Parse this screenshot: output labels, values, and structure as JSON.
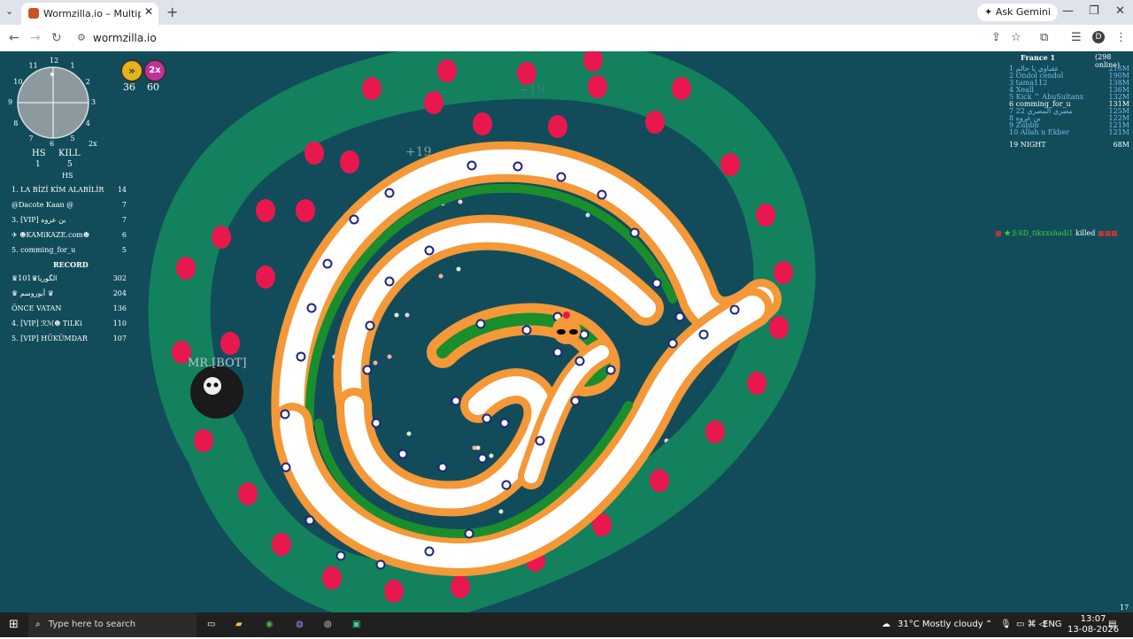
{
  "browser": {
    "tab_title": "Wormzilla.io – Multiplayer Snal",
    "url": "wormzilla.io",
    "ask_gemini": "Ask Gemini",
    "profile_initial": "D"
  },
  "hud": {
    "minimap_numbers": [
      "12",
      "1",
      "2",
      "3",
      "4",
      "5",
      "6",
      "7",
      "8",
      "9",
      "10",
      "11"
    ],
    "zoom_label": "2x",
    "hs_label": "HS",
    "kill_label": "KILL",
    "hs_value": "1",
    "kill_value": "5",
    "hs_section_label": "HS",
    "boost_count": "36",
    "multiplier_badge": "2x",
    "multiplier_count": "60"
  },
  "hs_list": [
    {
      "name": "1. LA BİZİ KİM ALABİLİR",
      "score": "14"
    },
    {
      "name": "@Dacote Kaan @",
      "score": "7"
    },
    {
      "name": "3. [VIP] بن عروه",
      "score": "7"
    },
    {
      "name": "✈ ☻KAMiKAZE.com☻",
      "score": "6"
    },
    {
      "name": "5. comming_for_u",
      "score": "5"
    }
  ],
  "record_label": "RECORD",
  "record_list": [
    {
      "name": "♛101♛الگوریا",
      "score": "302"
    },
    {
      "name": "♛ أبوروسم ♛",
      "score": "204"
    },
    {
      "name": "ÖNCE VATAN",
      "score": "136"
    },
    {
      "name": "4. [VIP] ℛℳ☻ TiLKi",
      "score": "110"
    },
    {
      "name": "5. [VIP] HÜKÜMDAR",
      "score": "107"
    }
  ],
  "server": {
    "name": "France 1",
    "online": "(298 online)"
  },
  "top_leaderboard": [
    {
      "rank": "1",
      "name": "عقباوي يا حالم",
      "score": "216M"
    },
    {
      "rank": "2",
      "name": "Ondol cendol",
      "score": "190M"
    },
    {
      "rank": "3",
      "name": "tama112",
      "score": "138M"
    },
    {
      "rank": "4",
      "name": "Xeall",
      "score": "136M"
    },
    {
      "rank": "5",
      "name": "Kick ^ AbuSultanx",
      "score": "132M"
    },
    {
      "rank": "6",
      "name": "comming_for_u",
      "score": "131M"
    },
    {
      "rank": "7",
      "name": "مصري المصري 22",
      "score": "125M"
    },
    {
      "rank": "8",
      "name": "بن عروه",
      "score": "122M"
    },
    {
      "rank": "9",
      "name": "Zubbb",
      "score": "121M"
    },
    {
      "rank": "10",
      "name": "Allah u Ekber",
      "score": "121M"
    }
  ],
  "own_rank": {
    "rank": "19",
    "name": "NIGHT",
    "score": "68M"
  },
  "kill_feed": {
    "killer": "★彡SD_tikxxshadi1",
    "verb": "killed"
  },
  "bot_label": "MR.[BOT]",
  "floating_points": [
    "+19",
    "+19"
  ],
  "corner_number": "17",
  "taskbar": {
    "search_placeholder": "Type here to search",
    "weather": "31°C  Mostly cloudy",
    "language": "ENG",
    "time": "13:07",
    "date": "13-08-2026"
  },
  "colors": {
    "ocean": "#124c5b",
    "snake_green": "#13805e",
    "snake_red_dot": "#e8184f",
    "flag_orange": "#f49838",
    "flag_white": "#ffffff",
    "flag_green": "#1a8e2c",
    "chakra_blue": "#1c2580"
  }
}
